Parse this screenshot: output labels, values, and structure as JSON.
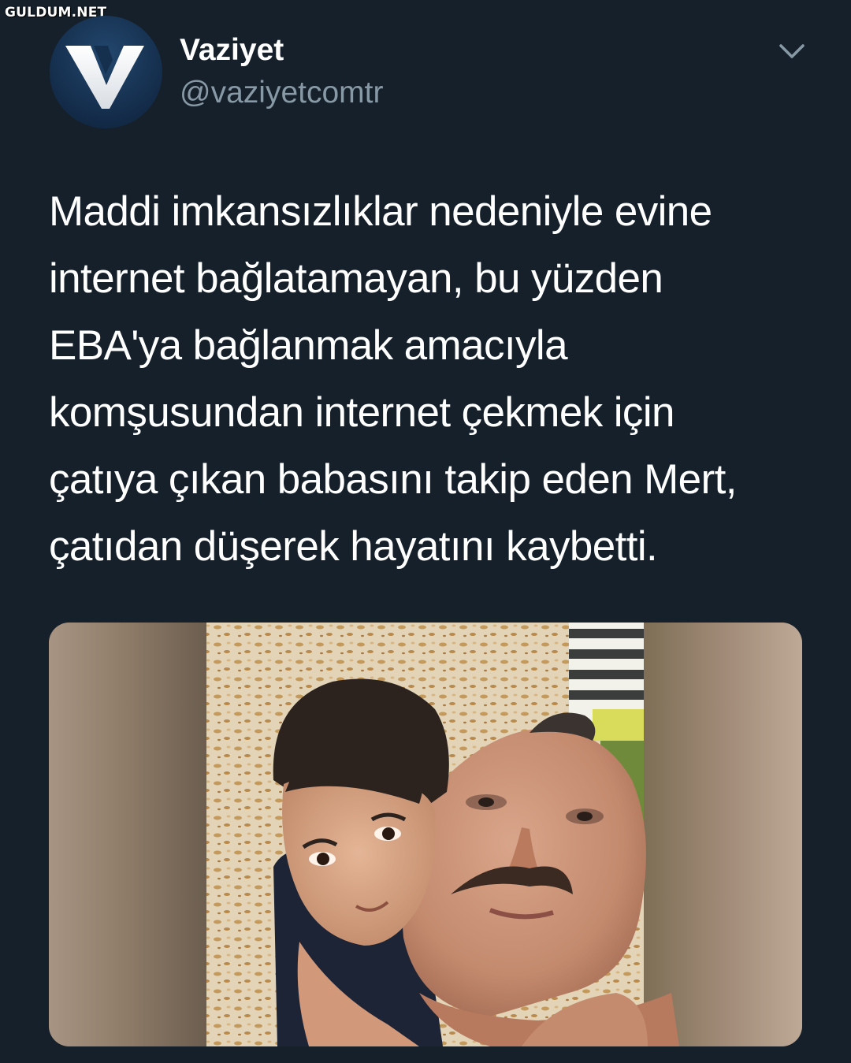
{
  "watermark": "GULDUM.NET",
  "tweet": {
    "author": {
      "name": "Vaziyet",
      "handle": "@vaziyetcomtr"
    },
    "text_lines": [
      "Maddi imkansızlıklar nedeniyle evine",
      "internet bağlatamayan, bu yüzden",
      "EBA'ya bağlanmak amacıyla",
      "komşusundan internet çekmek için",
      "çatıya çıkan babasını takip eden Mert,",
      "çatıdan düşerek hayatını kaybetti."
    ]
  },
  "icons": {
    "avatar": "vaziyet-v-logo",
    "menu": "chevron-down-icon"
  },
  "colors": {
    "background": "#15202b",
    "handle": "#8899a6",
    "text": "#ffffff"
  }
}
